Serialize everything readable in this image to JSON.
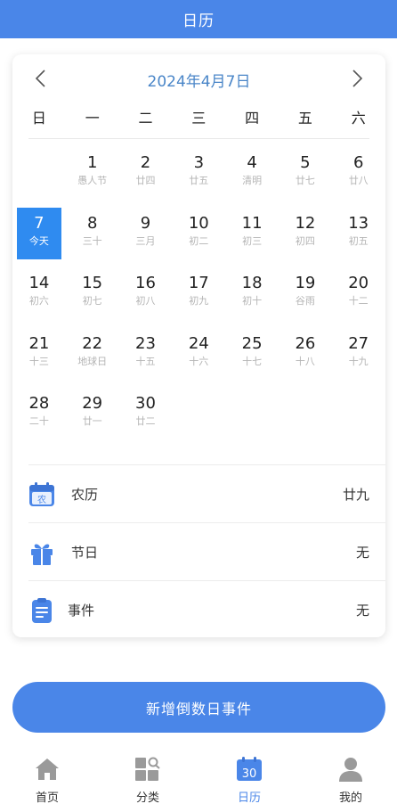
{
  "header": {
    "title": "日历"
  },
  "calendar": {
    "month_title": "2024年4月7日",
    "weekdays": [
      "日",
      "一",
      "二",
      "三",
      "四",
      "五",
      "六"
    ],
    "days": [
      {
        "day": "1",
        "lunar": "愚人节"
      },
      {
        "day": "2",
        "lunar": "廿四"
      },
      {
        "day": "3",
        "lunar": "廿五"
      },
      {
        "day": "4",
        "lunar": "清明"
      },
      {
        "day": "5",
        "lunar": "廿七"
      },
      {
        "day": "6",
        "lunar": "廿八"
      },
      {
        "day": "7",
        "lunar": "今天"
      },
      {
        "day": "8",
        "lunar": "三十"
      },
      {
        "day": "9",
        "lunar": "三月"
      },
      {
        "day": "10",
        "lunar": "初二"
      },
      {
        "day": "11",
        "lunar": "初三"
      },
      {
        "day": "12",
        "lunar": "初四"
      },
      {
        "day": "13",
        "lunar": "初五"
      },
      {
        "day": "14",
        "lunar": "初六"
      },
      {
        "day": "15",
        "lunar": "初七"
      },
      {
        "day": "16",
        "lunar": "初八"
      },
      {
        "day": "17",
        "lunar": "初九"
      },
      {
        "day": "18",
        "lunar": "初十"
      },
      {
        "day": "19",
        "lunar": "谷雨"
      },
      {
        "day": "20",
        "lunar": "十二"
      },
      {
        "day": "21",
        "lunar": "十三"
      },
      {
        "day": "22",
        "lunar": "地球日"
      },
      {
        "day": "23",
        "lunar": "十五"
      },
      {
        "day": "24",
        "lunar": "十六"
      },
      {
        "day": "25",
        "lunar": "十七"
      },
      {
        "day": "26",
        "lunar": "十八"
      },
      {
        "day": "27",
        "lunar": "十九"
      },
      {
        "day": "28",
        "lunar": "二十"
      },
      {
        "day": "29",
        "lunar": "廿一"
      },
      {
        "day": "30",
        "lunar": "廿二"
      }
    ],
    "first_weekday": 1,
    "selected_day": "7"
  },
  "info": {
    "lunar_label": "农历",
    "lunar_icon_text": "农",
    "lunar_value": "廿九",
    "festival_label": "节日",
    "festival_value": "无",
    "event_label": "事件",
    "event_value": "无"
  },
  "add_button": {
    "label": "新增倒数日事件"
  },
  "tabbar": {
    "tabs": [
      {
        "label": "首页",
        "icon": "home-icon"
      },
      {
        "label": "分类",
        "icon": "category-icon"
      },
      {
        "label": "日历",
        "icon": "calendar-icon",
        "icon_text": "30"
      },
      {
        "label": "我的",
        "icon": "user-icon"
      }
    ],
    "active": "日历"
  },
  "colors": {
    "accent": "#4a86e8",
    "selected": "#2f8bf0",
    "lunar_text": "#b5b5b5"
  }
}
